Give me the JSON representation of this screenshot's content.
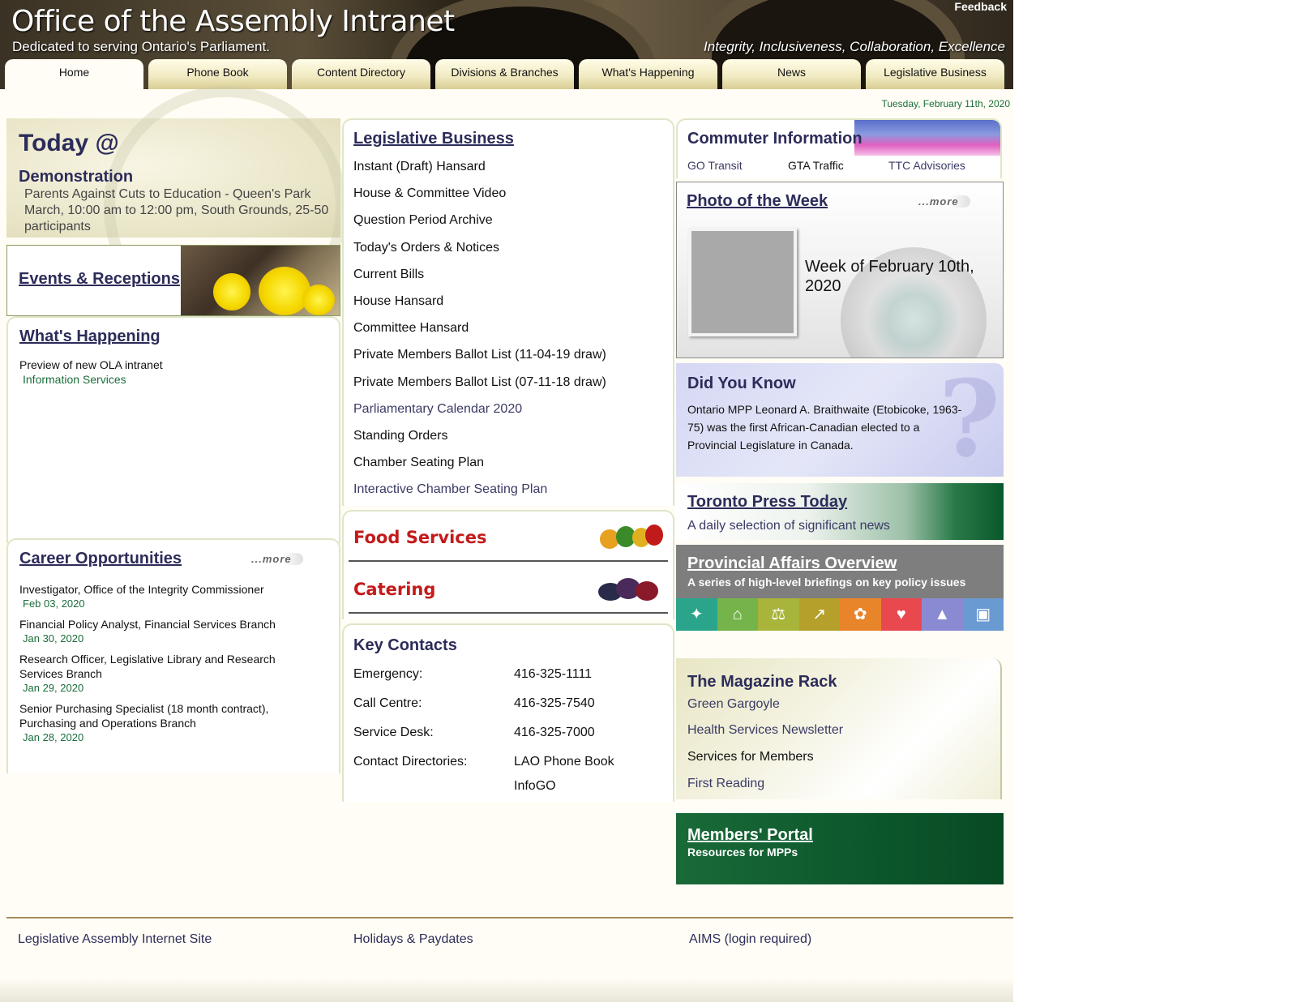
{
  "header": {
    "title": "Office of the Assembly Intranet",
    "subtitle": "Dedicated to serving Ontario's Parliament.",
    "feedback": "Feedback",
    "tagline": "Integrity, Inclusiveness, Collaboration, Excellence"
  },
  "nav": {
    "tabs": [
      "Home",
      "Phone Book",
      "Content Directory",
      "Divisions & Branches",
      "What's Happening",
      "News",
      "Legislative Business"
    ],
    "active": "Home"
  },
  "date": "Tuesday, February 11th, 2020",
  "today": {
    "title": "Today @",
    "event_title": "Demonstration",
    "event_text": "Parents Against Cuts to Education - Queen's Park March, 10:00 am to 12:00 pm, South Grounds, 25-50 participants"
  },
  "events": {
    "title": "Events & Receptions"
  },
  "happening": {
    "title": "What's Happening",
    "item": "Preview of new OLA intranet",
    "dept": "Information Services"
  },
  "career": {
    "title": "Career Opportunities",
    "more": "...more",
    "jobs": [
      {
        "title": "Investigator, Office of the Integrity Commissioner",
        "date": "Feb 03, 2020"
      },
      {
        "title": "Financial Policy Analyst, Financial Services Branch",
        "date": "Jan 30, 2020"
      },
      {
        "title": "Research Officer, Legislative Library and Research Services Branch",
        "date": "Jan 29, 2020"
      },
      {
        "title": "Senior Purchasing Specialist (18 month contract), Purchasing and Operations Branch",
        "date": "Jan 28, 2020"
      }
    ]
  },
  "legislative": {
    "title": "Legislative Business",
    "links": [
      "Instant (Draft) Hansard",
      "House & Committee Video",
      "Question Period Archive",
      "Today's Orders & Notices",
      "Current Bills",
      "House Hansard",
      "Committee Hansard",
      "Private Members Ballot List (11-04-19 draw)",
      "Private Members Ballot List (07-11-18 draw)",
      "Parliamentary Calendar 2020",
      "Standing Orders",
      "Chamber Seating Plan",
      "Interactive Chamber Seating Plan"
    ]
  },
  "food": {
    "food_services": "Food Services",
    "catering": "Catering"
  },
  "contacts": {
    "title": "Key Contacts",
    "rows": [
      {
        "label": "Emergency:",
        "value": "416-325-1111"
      },
      {
        "label": "Call Centre:",
        "value": "416-325-7540"
      },
      {
        "label": "Service Desk:",
        "value": "416-325-7000"
      },
      {
        "label": "Contact Directories:",
        "value": "LAO Phone Book"
      }
    ],
    "extra": "InfoGO"
  },
  "commuter": {
    "title": "Commuter Information",
    "links": [
      "GO Transit",
      "GTA Traffic",
      "TTC Advisories"
    ]
  },
  "photo": {
    "title": "Photo of the Week",
    "more": "...more",
    "caption": "Week of February 10th, 2020"
  },
  "didyouknow": {
    "title": "Did You Know",
    "text": "Ontario MPP Leonard A. Braithwaite (Etobicoke, 1963-75) was the first African-Canadian elected to a Provincial Legislature in Canada.",
    "mark": "?"
  },
  "press": {
    "title": "Toronto Press Today",
    "subtitle": "A daily selection of significant news"
  },
  "provincial": {
    "title": "Provincial Affairs Overview",
    "subtitle": "A series of high-level briefings on key policy issues",
    "icons": [
      {
        "name": "trillium-icon",
        "glyph": "✦",
        "color": "#2aa58c"
      },
      {
        "name": "city-icon",
        "glyph": "⌂",
        "color": "#74b44a"
      },
      {
        "name": "scales-icon",
        "glyph": "⚖",
        "color": "#a8b43a"
      },
      {
        "name": "chart-icon",
        "glyph": "↗",
        "color": "#b4a02a"
      },
      {
        "name": "tree-icon",
        "glyph": "✿",
        "color": "#e8842a"
      },
      {
        "name": "heart-icon",
        "glyph": "♥",
        "color": "#e8484e"
      },
      {
        "name": "graduation-icon",
        "glyph": "▲",
        "color": "#8a8ad2"
      },
      {
        "name": "train-icon",
        "glyph": "▣",
        "color": "#6a9ad2"
      }
    ]
  },
  "magazine": {
    "title": "The Magazine Rack",
    "links": [
      "Green Gargoyle",
      "Health Services Newsletter",
      "Services for Members",
      "First Reading"
    ]
  },
  "portal": {
    "title": "Members' Portal",
    "subtitle": "Resources for MPPs"
  },
  "footer": {
    "links": [
      "Legislative Assembly Internet Site",
      "Holidays & Paydates",
      "AIMS (login required)"
    ]
  }
}
